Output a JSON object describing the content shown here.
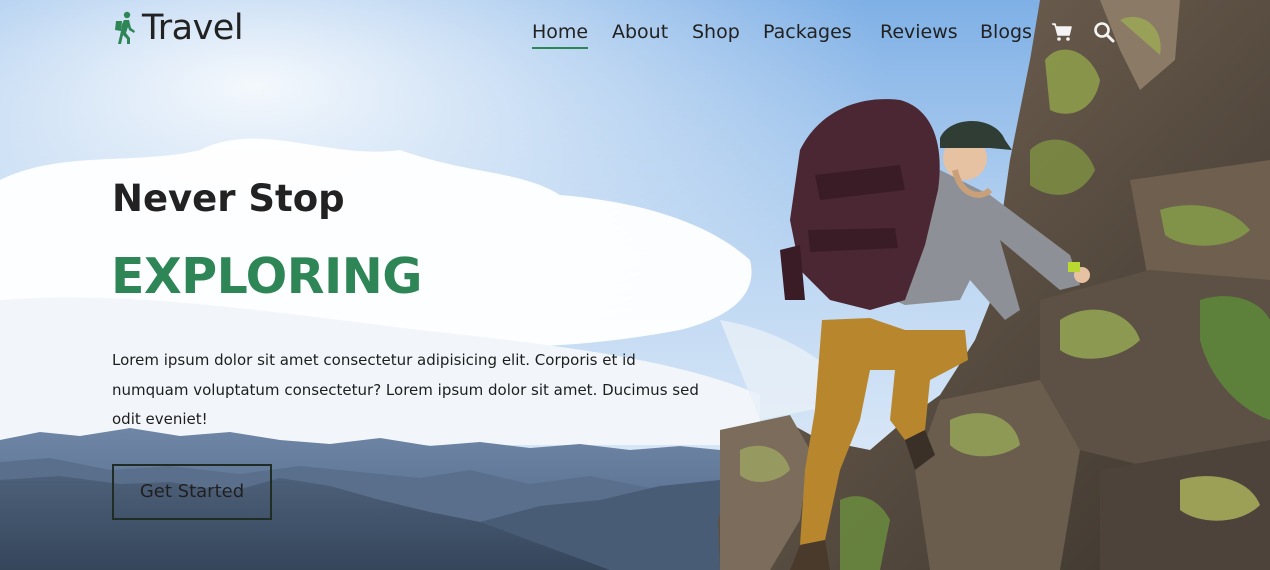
{
  "brand": {
    "name": "Travel",
    "logo_icon": "hiker-icon",
    "accent_color": "#2e8656"
  },
  "nav": {
    "items": [
      {
        "label": "Home",
        "active": true
      },
      {
        "label": "About"
      },
      {
        "label": "Shop"
      },
      {
        "label": "Packages"
      },
      {
        "label": "Reviews"
      },
      {
        "label": "Blogs"
      }
    ],
    "icons": [
      "shopping-cart-icon",
      "search-icon"
    ]
  },
  "hero": {
    "title_line_1": "Never Stop",
    "title_line_2": "EXPLORING",
    "description": "Lorem ipsum dolor sit amet consectetur adipisicing elit. Corporis et id numquam voluptatum consectetur? Lorem ipsum dolor sit amet. Ducimus sed odit eveniet!",
    "cta_label": "Get Started",
    "image": "woman-hiker-climbing-rocks"
  }
}
